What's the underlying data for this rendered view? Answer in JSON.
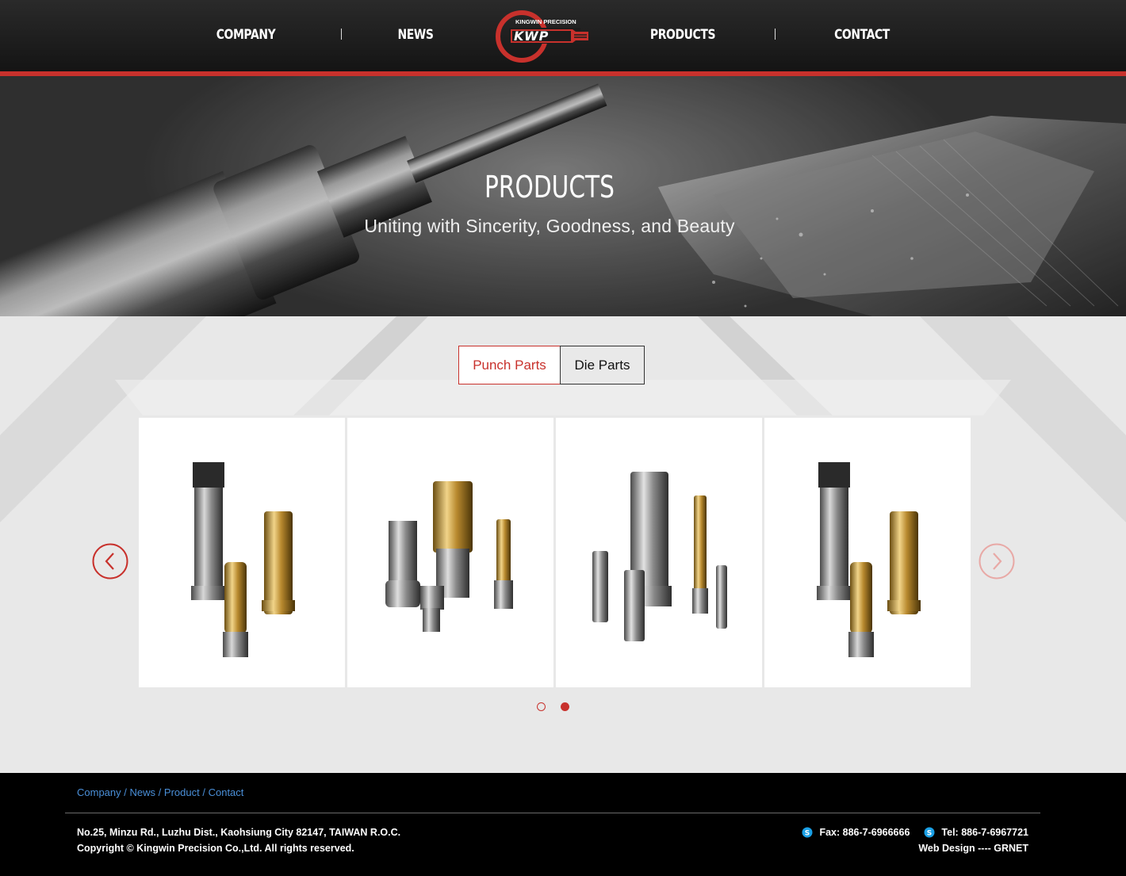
{
  "header": {
    "nav_left": [
      "COMPANY",
      "NEWS"
    ],
    "nav_right": [
      "PRODUCTS",
      "CONTACT"
    ],
    "logo": {
      "top_text": "KINGWIN PRECISION",
      "mark": "KWP"
    }
  },
  "hero": {
    "title": "PRODUCTS",
    "subtitle": "Uniting with Sincerity, Goodness, and Beauty"
  },
  "products": {
    "tabs": [
      {
        "label": "Punch Parts",
        "active": true
      },
      {
        "label": "Die Parts",
        "active": false
      }
    ],
    "cards": [
      {
        "icon": "punch-parts-set-1"
      },
      {
        "icon": "punch-parts-set-2"
      },
      {
        "icon": "torx-punch-set"
      },
      {
        "icon": "punch-parts-set-1"
      }
    ],
    "pagination": {
      "pages": 2,
      "current": 2
    }
  },
  "footer": {
    "links": [
      "Company",
      "News",
      "Product",
      "Contact"
    ],
    "separator": "/",
    "address": "No.25, Minzu Rd., Luzhu Dist., Kaohsiung City 82147, TAIWAN R.O.C.",
    "copyright": "Copyright © Kingwin Precision Co.,Ltd. All rights reserved.",
    "fax": "Fax: 886-7-6966666",
    "tel": "Tel: 886-7-6967721",
    "credit_prefix": "Web Design ---- ",
    "credit_name": "GRNET"
  },
  "colors": {
    "accent": "#c8312c",
    "link": "#4a8fd8",
    "header_bg": "#1d1d1d",
    "footer_bg": "#000000"
  }
}
